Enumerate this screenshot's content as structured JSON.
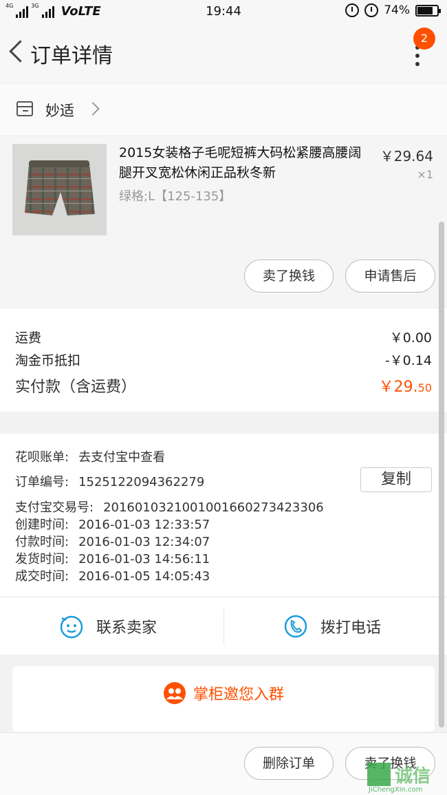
{
  "status_bar": {
    "net1": "4G",
    "net2": "3G",
    "volte": "VoLTE",
    "time": "19:44",
    "battery": "74%",
    "battery_level": 0.74
  },
  "header": {
    "title": "订单详情",
    "badge": "2"
  },
  "shop": {
    "name": "妙适"
  },
  "item": {
    "title": "2015女装格子毛呢短裤大码松紧腰高腰阔腿开叉宽松休闲正品秋冬新",
    "price": "￥29.64",
    "qty": "×1",
    "sku": "绿格;L【125-135】",
    "actions": [
      "卖了换钱",
      "申请售后"
    ]
  },
  "fees": {
    "shipping_label": "运费",
    "shipping_value": "￥0.00",
    "coin_label": "淘金币抵扣",
    "coin_value": "-￥0.14",
    "total_label": "实付款（含运费）",
    "total_int": "￥29.",
    "total_dec": "50"
  },
  "info": {
    "huabei_label": "花呗账单:",
    "huabei_value": "去支付宝中查看",
    "order_label": "订单编号:",
    "order_value": "1525122094362279",
    "copy_label": "复制",
    "alipay_label": "支付宝交易号:",
    "alipay_value": "2016010321001001660273423306",
    "created_label": "创建时间:",
    "created_value": "2016-01-03 12:33:57",
    "paid_label": "付款时间:",
    "paid_value": "2016-01-03 12:34:07",
    "shipped_label": "发货时间:",
    "shipped_value": "2016-01-03 14:56:11",
    "done_label": "成交时间:",
    "done_value": "2016-01-05 14:05:43"
  },
  "contact": {
    "chat": "联系卖家",
    "call": "拨打电话"
  },
  "group": {
    "label": "掌柜邀您入群"
  },
  "bottom": {
    "delete": "删除订单",
    "sell": "卖了换钱"
  },
  "watermark": {
    "cn": "诚信",
    "en": "JiChengXin.com"
  },
  "colors": {
    "accent": "#ff5000",
    "icon_blue": "#1a9cd8"
  }
}
